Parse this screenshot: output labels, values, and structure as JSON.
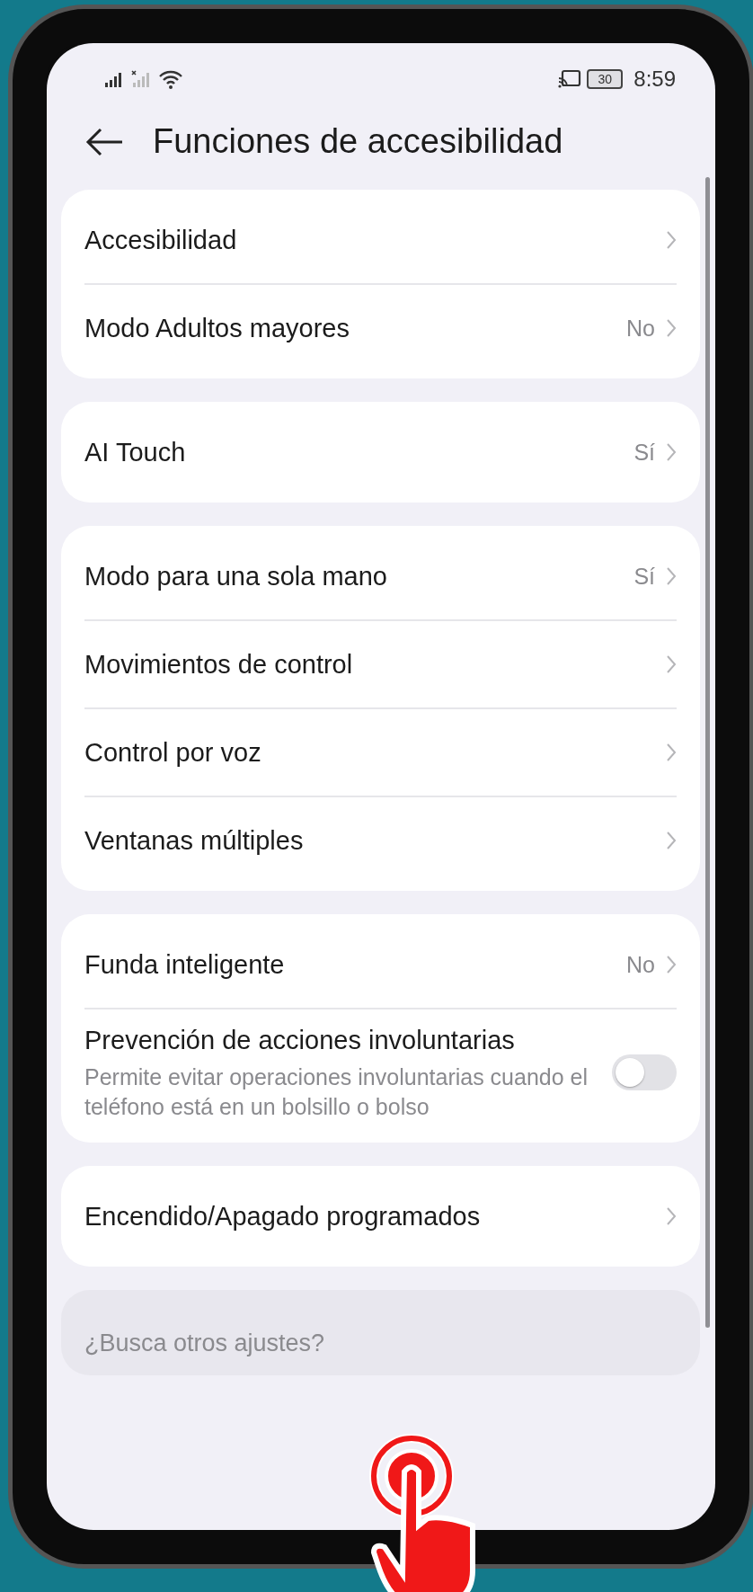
{
  "status_bar": {
    "time": "8:59",
    "battery": "30"
  },
  "header": {
    "title": "Funciones de accesibilidad"
  },
  "groups": [
    {
      "items": [
        {
          "kind": "link",
          "label": "Accesibilidad"
        },
        {
          "kind": "link",
          "label": "Modo Adultos mayores",
          "value": "No"
        }
      ]
    },
    {
      "items": [
        {
          "kind": "link",
          "label": "AI Touch",
          "value": "Sí"
        }
      ]
    },
    {
      "items": [
        {
          "kind": "link",
          "label": "Modo para una sola mano",
          "value": "Sí"
        },
        {
          "kind": "link",
          "label": "Movimientos de control"
        },
        {
          "kind": "link",
          "label": "Control por voz"
        },
        {
          "kind": "link",
          "label": "Ventanas múltiples"
        }
      ]
    },
    {
      "items": [
        {
          "kind": "link",
          "label": "Funda inteligente",
          "value": "No"
        },
        {
          "kind": "toggle",
          "label": "Prevención de acciones involuntarias",
          "description": "Permite evitar operaciones involuntarias cuando el teléfono está en un bolsillo o bolso",
          "on": false
        }
      ]
    },
    {
      "items": [
        {
          "kind": "link",
          "label": "Encendido/Apagado programados"
        }
      ]
    }
  ],
  "footer_card": {
    "text": "¿Busca otros ajustes?"
  }
}
